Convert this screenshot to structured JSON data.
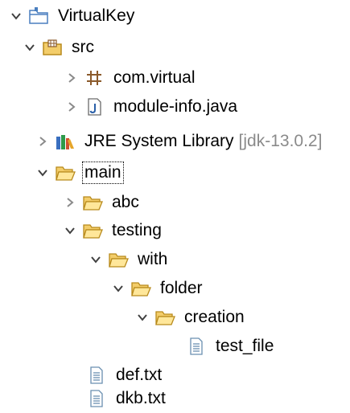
{
  "tree": {
    "project": {
      "label": "VirtualKey"
    },
    "src": {
      "label": "src"
    },
    "package": {
      "label": "com.virtual"
    },
    "module_info": {
      "label": "module-info.java"
    },
    "jre": {
      "label": "JRE System Library",
      "decoration": "[jdk-13.0.2]"
    },
    "main": {
      "label": "main"
    },
    "abc": {
      "label": "abc"
    },
    "testing": {
      "label": "testing"
    },
    "with": {
      "label": "with"
    },
    "folder": {
      "label": "folder"
    },
    "creation": {
      "label": "creation"
    },
    "test_file": {
      "label": "test_file"
    },
    "def_file": {
      "label": "def.txt"
    },
    "dkb_file": {
      "label": "dkb.txt"
    }
  },
  "icons": {
    "project": "project-folder-icon",
    "source_folder": "source-folder-icon",
    "package": "package-icon",
    "java_file": "java-file-icon",
    "library": "library-icon",
    "folder": "folder-icon",
    "text_file": "text-file-icon",
    "expanded": "chevron-down-icon",
    "collapsed": "chevron-right-icon"
  },
  "colors": {
    "folder": "#e8b84a",
    "folder_edge": "#b88a1c",
    "chevron": "#404040",
    "package": "#8b5a2b",
    "decoration": "#8a8a8a"
  }
}
